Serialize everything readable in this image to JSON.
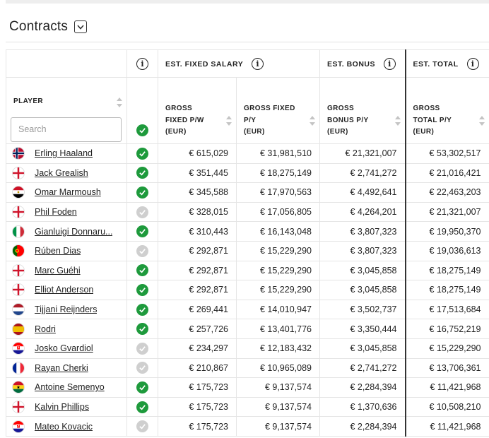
{
  "section": {
    "title": "Contracts",
    "toggle_icon": "chevron-down-icon"
  },
  "headers": {
    "player": "PLAYER",
    "search_placeholder": "Search",
    "fixed_salary": "EST. FIXED SALARY",
    "bonus": "EST. BONUS",
    "total": "EST. TOTAL",
    "gross_fixed_pw": [
      "GROSS",
      "FIXED P/W",
      "(EUR)"
    ],
    "gross_fixed_py": [
      "GROSS FIXED",
      "P/Y",
      "(EUR)"
    ],
    "gross_bonus_py": [
      "GROSS",
      "BONUS P/Y",
      "(EUR)"
    ],
    "gross_total_py": [
      "GROSS",
      "TOTAL P/Y",
      "(EUR)"
    ]
  },
  "colors": {
    "check_on": "#1e9a3c",
    "check_off": "#cfcfcf",
    "accent_border": "#333333"
  },
  "players": [
    {
      "name": "Erling Haaland",
      "flag": "norway",
      "active": true,
      "fixed_pw": "€ 615,029",
      "fixed_py": "€ 31,981,510",
      "bonus_py": "€ 21,321,007",
      "total_py": "€ 53,302,517"
    },
    {
      "name": "Jack Grealish",
      "flag": "england",
      "active": true,
      "fixed_pw": "€ 351,445",
      "fixed_py": "€ 18,275,149",
      "bonus_py": "€ 2,741,272",
      "total_py": "€ 21,016,421"
    },
    {
      "name": "Omar Marmoush",
      "flag": "egypt",
      "active": true,
      "fixed_pw": "€ 345,588",
      "fixed_py": "€ 17,970,563",
      "bonus_py": "€ 4,492,641",
      "total_py": "€ 22,463,203"
    },
    {
      "name": "Phil Foden",
      "flag": "england",
      "active": false,
      "fixed_pw": "€ 328,015",
      "fixed_py": "€ 17,056,805",
      "bonus_py": "€ 4,264,201",
      "total_py": "€ 21,321,007"
    },
    {
      "name": "Gianluigi Donnaru...",
      "flag": "italy",
      "active": true,
      "fixed_pw": "€ 310,443",
      "fixed_py": "€ 16,143,048",
      "bonus_py": "€ 3,807,323",
      "total_py": "€ 19,950,370"
    },
    {
      "name": "Rúben Dias",
      "flag": "portugal",
      "active": false,
      "fixed_pw": "€ 292,871",
      "fixed_py": "€ 15,229,290",
      "bonus_py": "€ 3,807,323",
      "total_py": "€ 19,036,613"
    },
    {
      "name": "Marc Guéhi",
      "flag": "england",
      "active": true,
      "fixed_pw": "€ 292,871",
      "fixed_py": "€ 15,229,290",
      "bonus_py": "€ 3,045,858",
      "total_py": "€ 18,275,149"
    },
    {
      "name": "Elliot Anderson",
      "flag": "england",
      "active": true,
      "fixed_pw": "€ 292,871",
      "fixed_py": "€ 15,229,290",
      "bonus_py": "€ 3,045,858",
      "total_py": "€ 18,275,149"
    },
    {
      "name": "Tijjani Reijnders",
      "flag": "netherlands",
      "active": true,
      "fixed_pw": "€ 269,441",
      "fixed_py": "€ 14,010,947",
      "bonus_py": "€ 3,502,737",
      "total_py": "€ 17,513,684"
    },
    {
      "name": "Rodri",
      "flag": "spain",
      "active": true,
      "fixed_pw": "€ 257,726",
      "fixed_py": "€ 13,401,776",
      "bonus_py": "€ 3,350,444",
      "total_py": "€ 16,752,219"
    },
    {
      "name": "Josko Gvardiol",
      "flag": "croatia",
      "active": false,
      "fixed_pw": "€ 234,297",
      "fixed_py": "€ 12,183,432",
      "bonus_py": "€ 3,045,858",
      "total_py": "€ 15,229,290"
    },
    {
      "name": "Rayan Cherki",
      "flag": "france",
      "active": false,
      "fixed_pw": "€ 210,867",
      "fixed_py": "€ 10,965,089",
      "bonus_py": "€ 2,741,272",
      "total_py": "€ 13,706,361"
    },
    {
      "name": "Antoine Semenyo",
      "flag": "ghana",
      "active": true,
      "fixed_pw": "€ 175,723",
      "fixed_py": "€ 9,137,574",
      "bonus_py": "€ 2,284,394",
      "total_py": "€ 11,421,968"
    },
    {
      "name": "Kalvin Phillips",
      "flag": "england",
      "active": true,
      "fixed_pw": "€ 175,723",
      "fixed_py": "€ 9,137,574",
      "bonus_py": "€ 1,370,636",
      "total_py": "€ 10,508,210"
    },
    {
      "name": "Mateo Kovacic",
      "flag": "croatia",
      "active": false,
      "fixed_pw": "€ 175,723",
      "fixed_py": "€ 9,137,574",
      "bonus_py": "€ 2,284,394",
      "total_py": "€ 11,421,968"
    }
  ]
}
